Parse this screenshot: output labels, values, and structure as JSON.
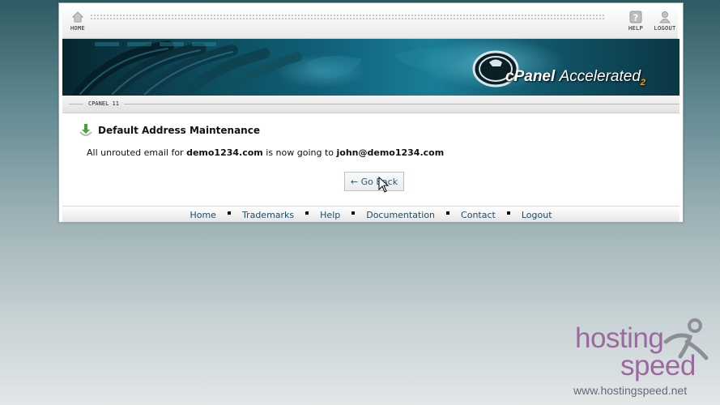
{
  "topbar": {
    "home_label": "HOME",
    "help_label": "HELP",
    "logout_label": "LOGOUT"
  },
  "banner": {
    "brand_c": "c",
    "brand_panel": "Panel",
    "brand_accelerated": "Accelerated",
    "brand_version": "2"
  },
  "crumb": {
    "label": "CPANEL 11"
  },
  "content": {
    "heading": "Default Address Maintenance",
    "msg_prefix": "All unrouted email for ",
    "domain": "demo1234.com",
    "msg_middle": " is now going to ",
    "target": "john@demo1234.com",
    "go_back_label": "← Go Back"
  },
  "footer": {
    "links": [
      "Home",
      "Trademarks",
      "Help",
      "Documentation",
      "Contact",
      "Logout"
    ]
  },
  "watermark": {
    "hosting": "hosting",
    "speed": "speed",
    "url": "www.hostingspeed.net"
  },
  "colors": {
    "accent_purple": "#9a6a9e",
    "link_blue": "#1b4c6d",
    "banner_teal": "#0f6078"
  }
}
